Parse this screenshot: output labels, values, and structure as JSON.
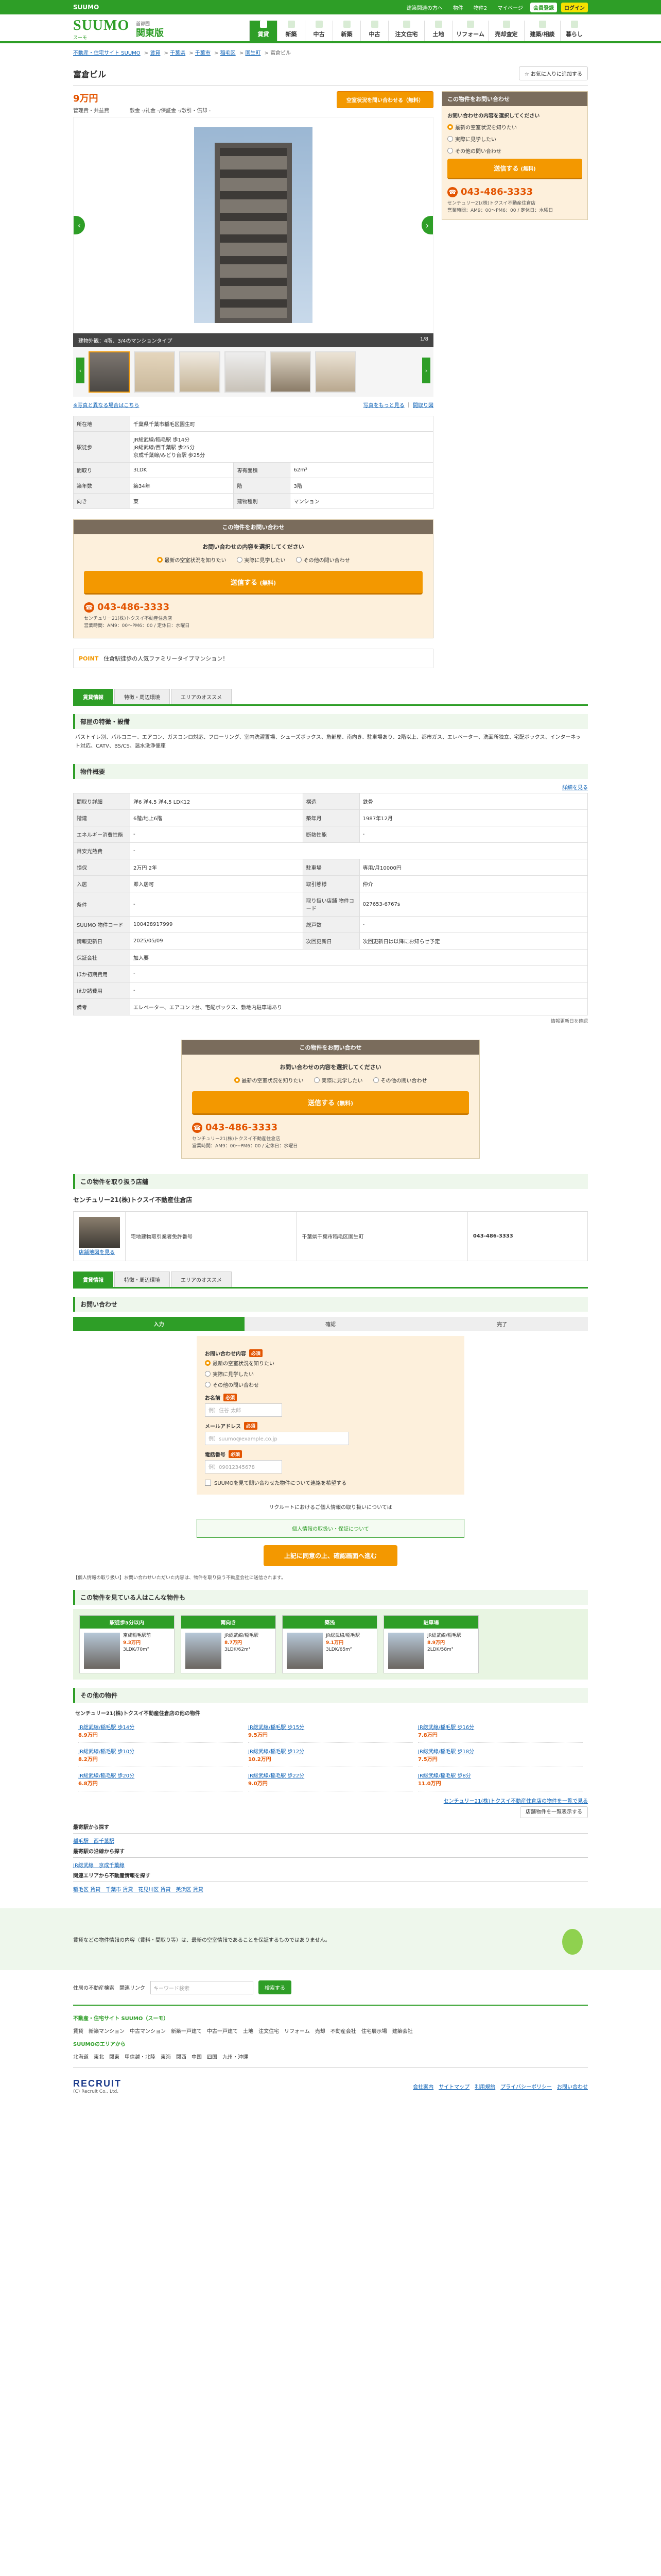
{
  "topbar": {
    "brand": "SUUMO",
    "links": [
      "建築関連の方へ",
      "物件",
      "物件2",
      "マイページ"
    ],
    "register": "会員登録",
    "login": "ログイン"
  },
  "header": {
    "sub_links": [
      "賃貸住宅を探す",
      "売りたい",
      "物件を掲載する"
    ],
    "sub_right": [
      "リフォーム",
      "住まいの窓口"
    ],
    "logo": "SUUMO",
    "logo_sub": "スーモ",
    "region": "関東版",
    "region_sub": "首都圏",
    "gnav": [
      "賃貸",
      "新築",
      "中古",
      "新築",
      "中古",
      "注文住宅",
      "土地",
      "リフォーム",
      "売却査定",
      "建築/相談",
      "暮らし"
    ]
  },
  "breadcrumb": [
    "不動産・住宅サイト SUUMO",
    "賃貸",
    "千葉県",
    "千葉市",
    "稲毛区",
    "園生町",
    "富倉ビル"
  ],
  "title": "富倉ビル",
  "fav": "お気に入りに追加する",
  "price": {
    "rent": "9万円",
    "sub": "管理費・共益費　　　　敷金 -/礼金 -/保証金 -/敷引・償却 -",
    "btn": "空室状況を問い合わせる（無料）"
  },
  "gallery": {
    "caption": "建物外観：4階、3/4のマンションタイプ",
    "count": "1/8",
    "note_l": "※写真と異なる場合はこちら",
    "note_r1": "写真をもっと見る",
    "note_r2": "間取り図"
  },
  "spec": [
    [
      "所在地",
      "千葉県千葉市稲毛区園生町",
      ""
    ],
    [
      "駅徒歩",
      "JR総武線/稲毛駅 歩14分\nJR総武線/西千葉駅 歩25分\n京成千葉線/みどり台駅 歩25分",
      ""
    ],
    [
      "間取り",
      "3LDK",
      "専有面積",
      "62m²"
    ],
    [
      "築年数",
      "築34年",
      "階",
      "3階"
    ],
    [
      "向き",
      "東",
      "建物種別",
      "マンション"
    ]
  ],
  "inquiry": {
    "header": "この物件をお問い合わせ",
    "question": "お問い合わせの内容を選択してください",
    "opts": [
      "最新の空室状況を知りたい",
      "実際に見学したい",
      "その他の問い合わせ"
    ],
    "btn": "送信する",
    "btn_sub": "(無料)",
    "tel": "043-486-3333",
    "shop": "センチュリー21(株)トクスイ不動産住倉店",
    "shop_info": "営業時間：AM9：00〜PM6：00 / 定休日：水曜日"
  },
  "point": {
    "tag": "POINT",
    "text": "住倉駅徒歩の人気ファミリータイプマンション！"
  },
  "tabs": [
    "賃貸情報",
    "特徴・周辺環境",
    "エリアのオススメ"
  ],
  "features": {
    "head": "部屋の特徴・設備",
    "text": "バストイレ別、バルコニー、エアコン、ガスコンロ対応、フローリング、室内洗濯置場、シューズボックス、角部屋、南向き、駐車場あり、2階以上、都市ガス、エレベーター、洗面所独立、宅配ボックス、インターネット対応、CATV、BS/CS、温水洗浄便座"
  },
  "detail": {
    "head": "物件概要",
    "link": "詳細を見る",
    "rows": [
      [
        "間取り詳細",
        "洋6 洋4.5 洋4.5 LDK12",
        "構造",
        "鉄骨"
      ],
      [
        "階建",
        "6階/地上6階",
        "築年月",
        "1987年12月"
      ],
      [
        "エネルギー消費性能",
        "-",
        "断熱性能",
        "-"
      ],
      [
        "目安光熱費",
        "-",
        "",
        ""
      ],
      [
        "損保",
        "2万円 2年",
        "駐車場",
        "専用/月10000円"
      ],
      [
        "入居",
        "即入居可",
        "取引態様",
        "仲介"
      ],
      [
        "条件",
        "-",
        "取り扱い店舗 物件コード",
        "027653-6767s"
      ],
      [
        "SUUMO 物件コード",
        "100428917999",
        "総戸数",
        "-"
      ],
      [
        "情報更新日",
        "2025/05/09",
        "次回更新日",
        "次回更新日は以降にお知らせ予定"
      ],
      [
        "保証会社",
        "加入要"
      ],
      [
        "ほか初期費用",
        "-"
      ],
      [
        "ほか諸費用",
        "-"
      ],
      [
        "備考",
        "エレベーター、エアコン 2台、宅配ボックス、敷地内駐車場あり"
      ]
    ],
    "note": "情報更新日を確認"
  },
  "shop_sec": {
    "head": "この物件を取り扱う店舗",
    "name": "センチュリー21(株)トクスイ不動産住倉店",
    "addr": "千葉県千葉市稲毛区園生町",
    "tel": "043-486-3333",
    "license": "宅地建物取引業者免許番号",
    "map": "店舗地図を見る"
  },
  "form": {
    "head": "お問い合わせ",
    "steps": [
      "入力",
      "確認",
      "完了"
    ],
    "top_note": "お問い合わせ内容",
    "q": "お問い合わせ内容",
    "name_lbl": "お名前",
    "name_ph": "例）住谷 太郎",
    "mail_lbl": "メールアドレス",
    "mail_ph": "例）suumo@example.co.jp",
    "tel_lbl": "電話番号",
    "tel_ph": "例）09012345678",
    "check": "SUUMOを見て問い合わせた物件について連絡を希望する",
    "consent": "リクルートにおけるご個人情報の取り扱いについては",
    "green": "個人情報の取扱い・保証について",
    "submit": "上記に同意の上、確認画面へ進む",
    "notice": "【個人情報の取り扱い】お問い合わせいただいた内容は、物件を取り扱う不動産会社に送信されます。"
  },
  "recs": {
    "head": "この物件を見ている人はこんな物件も",
    "items": [
      {
        "tag": "駅徒歩5分以内",
        "name": "京成稲毛駅前",
        "price": "9.3万円",
        "detail": "3LDK/70m²"
      },
      {
        "tag": "南向き",
        "name": "JR総武線/稲毛駅",
        "price": "8.7万円",
        "detail": "3LDK/62m²"
      },
      {
        "tag": "築浅",
        "name": "JR総武線/稲毛駅",
        "price": "9.1万円",
        "detail": "3LDK/65m²"
      },
      {
        "tag": "駐車場",
        "name": "JR総武線/稲毛駅",
        "price": "8.9万円",
        "detail": "2LDK/58m²"
      }
    ]
  },
  "others": {
    "head": "その他の物件",
    "sub": "センチュリー21(株)トクスイ不動産住倉店の他の物件",
    "items": [
      {
        "l": "JR総武線/稲毛駅 歩14分",
        "p": "8.9万円"
      },
      {
        "l": "JR総武線/稲毛駅 歩15分",
        "p": "9.5万円"
      },
      {
        "l": "JR総武線/稲毛駅 歩16分",
        "p": "7.8万円"
      },
      {
        "l": "JR総武線/稲毛駅 歩10分",
        "p": "8.2万円"
      },
      {
        "l": "JR総武線/稲毛駅 歩12分",
        "p": "10.2万円"
      },
      {
        "l": "JR総武線/稲毛駅 歩18分",
        "p": "7.5万円"
      },
      {
        "l": "JR総武線/稲毛駅 歩20分",
        "p": "6.8万円"
      },
      {
        "l": "JR総武線/稲毛駅 歩22分",
        "p": "9.0万円"
      },
      {
        "l": "JR総武線/稲毛駅 歩8分",
        "p": "11.0万円"
      }
    ],
    "more": "センチュリー21(株)トクスイ不動産住倉店の物件を一覧で見る",
    "btn": "店舗物件を一覧表示する"
  },
  "links": [
    {
      "h": "最寄駅から探す",
      "v": "稲毛駅　西千葉駅"
    },
    {
      "h": "最寄駅の沿線から探す",
      "v": "JR総武線　京成千葉線"
    },
    {
      "h": "関連エリアから不動産情報を探す",
      "v": "稲毛区 賃貸　千葉市 賃貸　花見川区 賃貸　美浜区 賃貸"
    }
  ],
  "foot_note": "賃貸などの物件情報の内容（賃料・間取り等）は、最新の空室情報であることを保証するものではありません。",
  "search": {
    "label": "住居の不動産検索",
    "label2": "関連リンク",
    "ph": "キーワード検索",
    "btn": "検索する"
  },
  "foot_links": {
    "h1": "不動産・住宅サイト SUUMO（スーモ）",
    "l1": "賃貸　新築マンション　中古マンション　新築一戸建て　中古一戸建て　土地　注文住宅　リフォーム　売却　不動産会社　住宅展示場　建築会社",
    "h2": "SUUMOのエリアから",
    "l2": "北海道　東北　関東　甲信越・北陸　東海　関西　中国　四国　九州・沖縄"
  },
  "footer": {
    "brand": "RECRUIT",
    "copy": "(C) Recruit Co., Ltd.",
    "links": [
      "会社案内",
      "サイトマップ",
      "利用規約",
      "プライバシーポリシー",
      "お問い合わせ"
    ]
  },
  "pagetop": "ページの先頭へ"
}
